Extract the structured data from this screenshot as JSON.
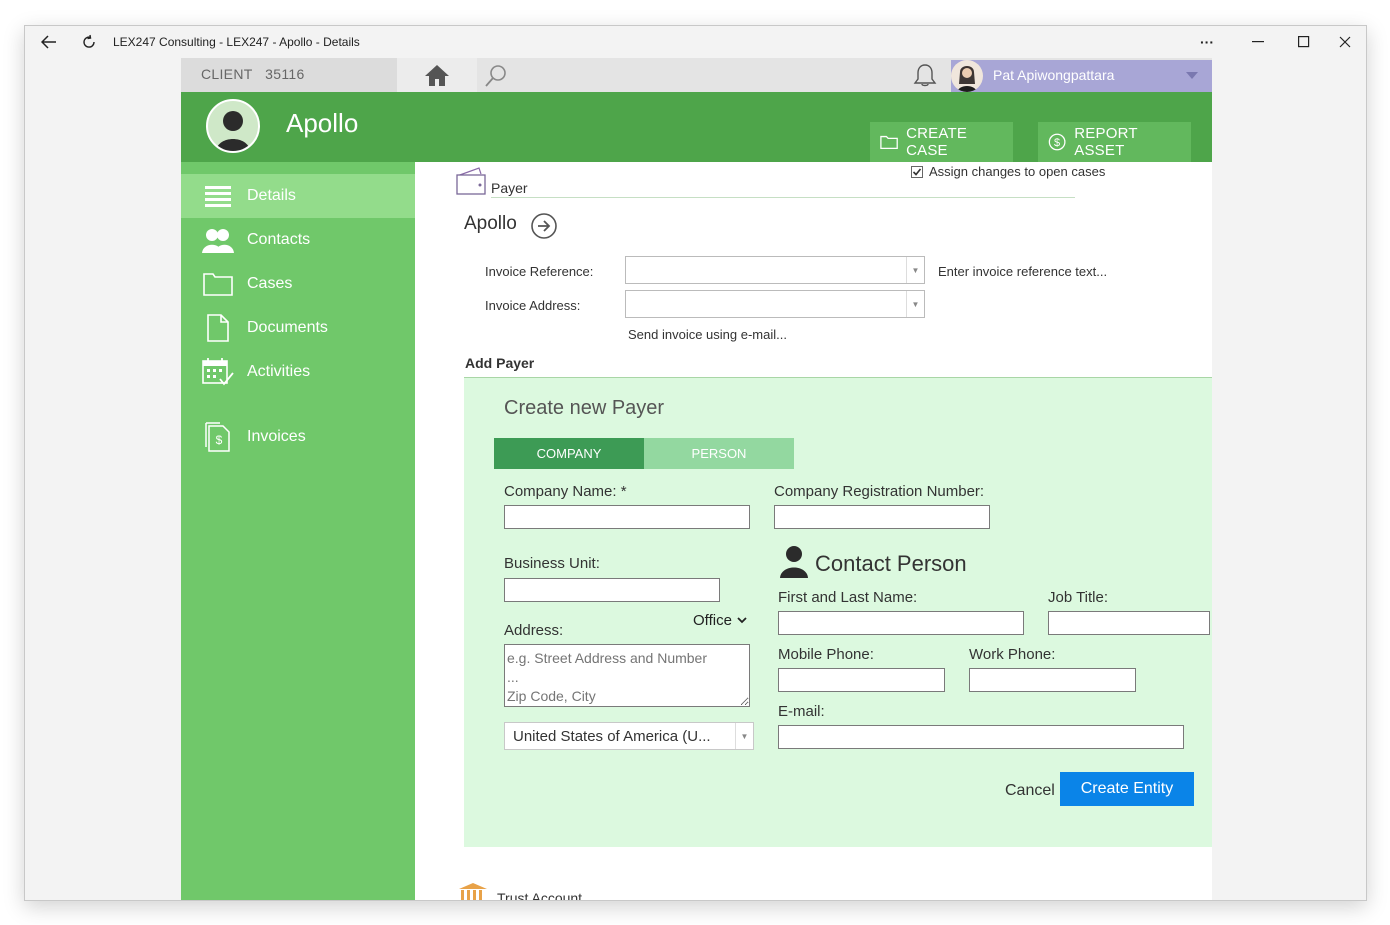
{
  "window": {
    "title": "LEX247 Consulting - LEX247 - Apollo - Details",
    "more_label": "···"
  },
  "topbar": {
    "client_label": "CLIENT",
    "client_number": "35116",
    "user_name": "Pat Apiwongpattara"
  },
  "header": {
    "client_name": "Apollo",
    "create_case_label": "CREATE CASE",
    "report_asset_label": "REPORT ASSET",
    "assign_changes_label": "Assign changes to open cases"
  },
  "sidebar": {
    "items": [
      {
        "label": "Details",
        "icon": "list-icon"
      },
      {
        "label": "Contacts",
        "icon": "contacts-icon"
      },
      {
        "label": "Cases",
        "icon": "folder-icon"
      },
      {
        "label": "Documents",
        "icon": "document-icon"
      },
      {
        "label": "Activities",
        "icon": "calendar-icon"
      },
      {
        "label": "Invoices",
        "icon": "invoice-icon"
      }
    ]
  },
  "payer": {
    "section_label": "Payer",
    "payer_name": "Apollo",
    "invoice_reference_label": "Invoice Reference:",
    "invoice_reference_value": "",
    "invoice_reference_hint": "Enter invoice reference text...",
    "invoice_address_label": "Invoice Address:",
    "invoice_address_value": "",
    "send_email_link": "Send invoice using e-mail...",
    "add_payer_label": "Add Payer"
  },
  "form": {
    "title": "Create new Payer",
    "tabs": [
      {
        "label": "COMPANY",
        "active": true
      },
      {
        "label": "PERSON",
        "active": false
      }
    ],
    "company_name_label": "Company Name: *",
    "company_name_value": "",
    "company_reg_label": "Company Registration Number:",
    "company_reg_value": "",
    "business_unit_label": "Business Unit:",
    "business_unit_value": "",
    "address_label": "Address:",
    "address_type": "Office",
    "address_placeholder": "e.g. Street Address and Number\n...\nZip Code, City",
    "country_value": "United States of America (U...",
    "contact_person_title": "Contact Person",
    "first_last_label": "First and Last Name:",
    "job_title_label": "Job Title:",
    "mobile_phone_label": "Mobile Phone:",
    "work_phone_label": "Work Phone:",
    "email_label": "E-mail:",
    "cancel_label": "Cancel",
    "create_label": "Create Entity"
  },
  "trust": {
    "label": "Trust Account"
  },
  "colors": {
    "header_green": "#4ea54a",
    "sidebar_green": "#70c86a",
    "active_nav": "#93dc8b",
    "panel_bg": "#dcf9df",
    "primary_blue": "#0a84e8",
    "user_bar": "#a8a6d6"
  }
}
